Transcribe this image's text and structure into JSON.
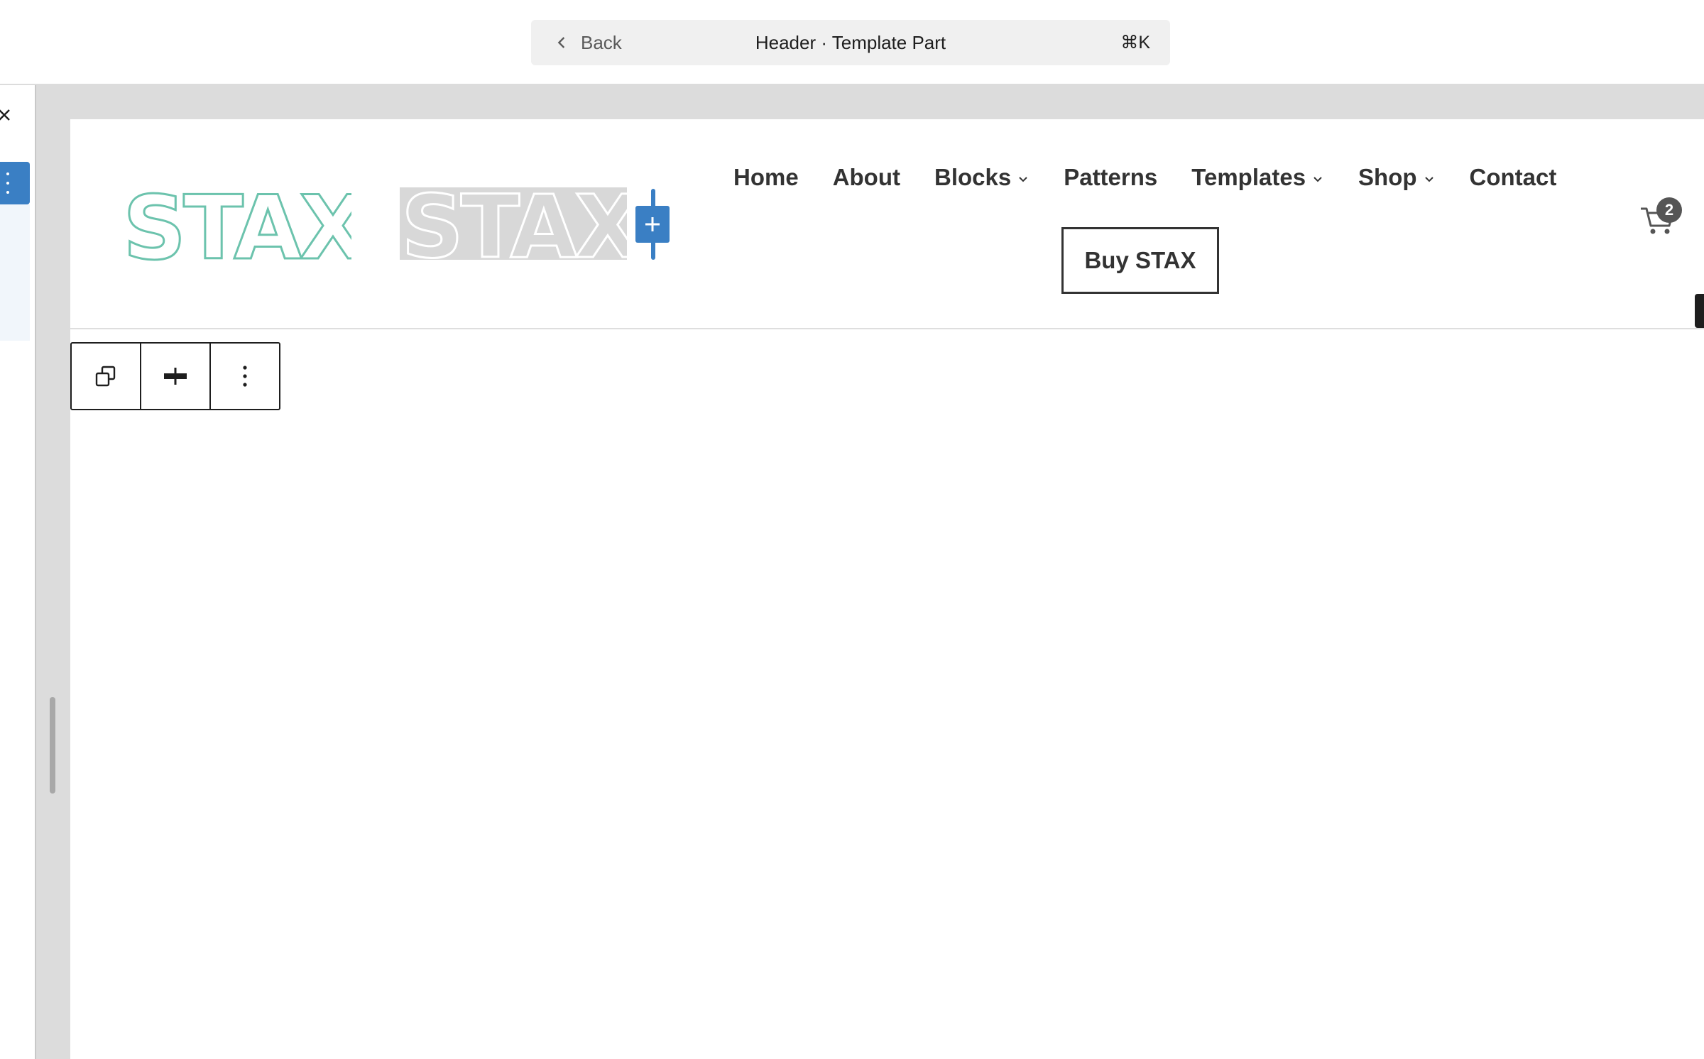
{
  "command_bar": {
    "back_label": "Back",
    "title": "Header · Template Part",
    "shortcut": "⌘K"
  },
  "sidebar": {
    "close_icon": "close-icon",
    "options_icon": "more-vertical-icon"
  },
  "header": {
    "logo_text": "STAX",
    "logo_placeholder_text": "STAX",
    "logo_color": "#6cc3ad",
    "inserter_icon": "plus-icon",
    "accent_color": "#3a7fc4",
    "nav": [
      {
        "label": "Home",
        "has_submenu": false
      },
      {
        "label": "About",
        "has_submenu": false
      },
      {
        "label": "Blocks",
        "has_submenu": true
      },
      {
        "label": "Patterns",
        "has_submenu": false
      },
      {
        "label": "Templates",
        "has_submenu": true
      },
      {
        "label": "Shop",
        "has_submenu": true
      },
      {
        "label": "Contact",
        "has_submenu": false
      }
    ],
    "cta_label": "Buy STAX",
    "cart_icon": "cart-icon",
    "cart_count": "2"
  },
  "block_toolbar": {
    "buttons": [
      {
        "icon": "duplicate-icon"
      },
      {
        "icon": "justify-center-icon"
      },
      {
        "icon": "more-vertical-icon"
      }
    ]
  }
}
